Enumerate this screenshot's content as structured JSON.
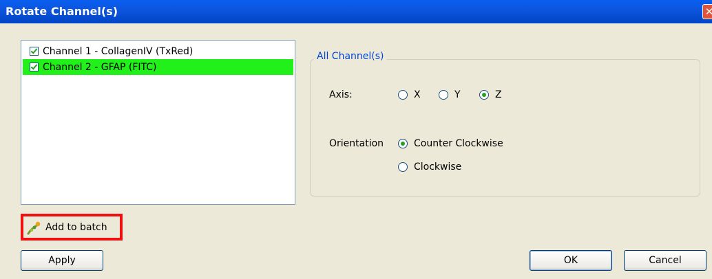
{
  "window": {
    "title": "Rotate Channel(s)"
  },
  "channels": [
    {
      "label": "Channel 1 - CollagenIV (TxRed)",
      "checked": true,
      "selected": false
    },
    {
      "label": "Channel 2 - GFAP (FITC)",
      "checked": true,
      "selected": true
    }
  ],
  "group": {
    "title": "All Channel(s)",
    "axis_label": "Axis:",
    "axis_options": [
      "X",
      "Y",
      "Z"
    ],
    "axis_selected": "Z",
    "orientation_label": "Orientation",
    "orientation_options": [
      "Counter Clockwise",
      "Clockwise"
    ],
    "orientation_selected": "Counter Clockwise"
  },
  "actions": {
    "add_to_batch": "Add to batch",
    "apply": "Apply",
    "ok": "OK",
    "cancel": "Cancel"
  },
  "colors": {
    "title_bar": "#0c56df",
    "selected_row": "#22f01a",
    "highlight_border": "#ee1111",
    "group_title": "#0046d5"
  },
  "icons": {
    "close": "close-icon",
    "batch": "add-to-batch-icon"
  }
}
